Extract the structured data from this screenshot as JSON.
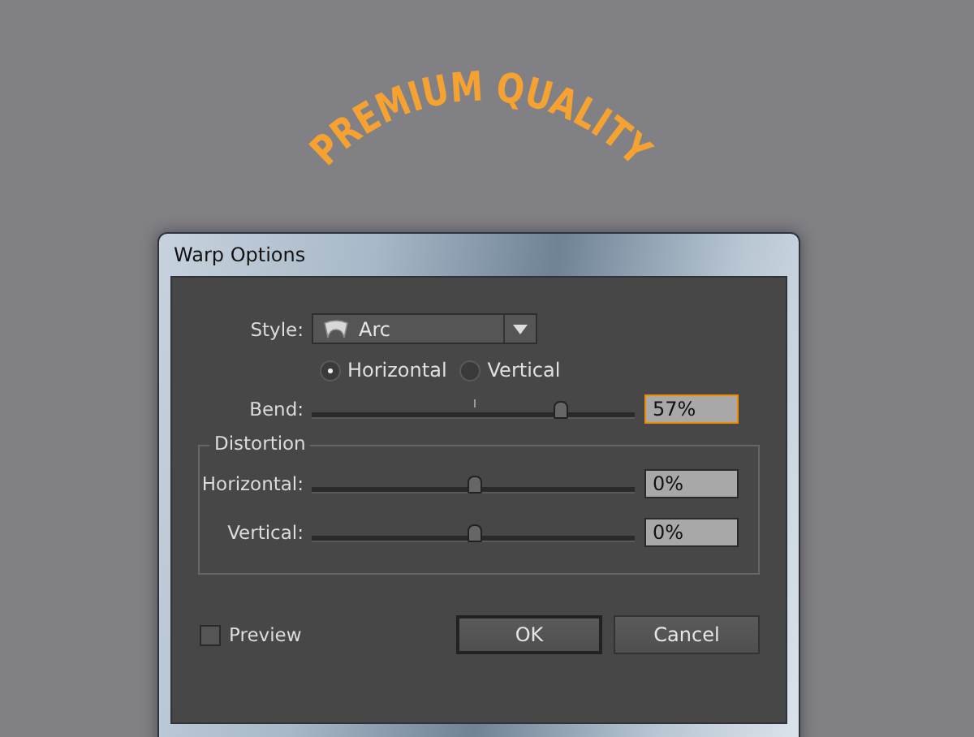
{
  "artwork": {
    "text": "PREMIUM QUALITY"
  },
  "dialog": {
    "title": "Warp Options",
    "style": {
      "label": "Style:",
      "value": "Arc"
    },
    "orientation": [
      {
        "label": "Horizontal",
        "selected": true
      },
      {
        "label": "Vertical",
        "selected": false
      }
    ],
    "bend": {
      "label": "Bend:",
      "level": 0.77,
      "value": "57%",
      "focused": true
    },
    "distortion": {
      "title": "Distortion",
      "sliders": [
        {
          "label": "Horizontal:",
          "level": 0.5,
          "value": "0%",
          "focused": false
        },
        {
          "label": "Vertical:",
          "level": 0.5,
          "value": "0%",
          "focused": false
        }
      ]
    },
    "preview": {
      "label": "Preview",
      "checked": false
    },
    "buttons": [
      {
        "label": "OK",
        "default": true
      },
      {
        "label": "Cancel",
        "default": false
      }
    ]
  }
}
